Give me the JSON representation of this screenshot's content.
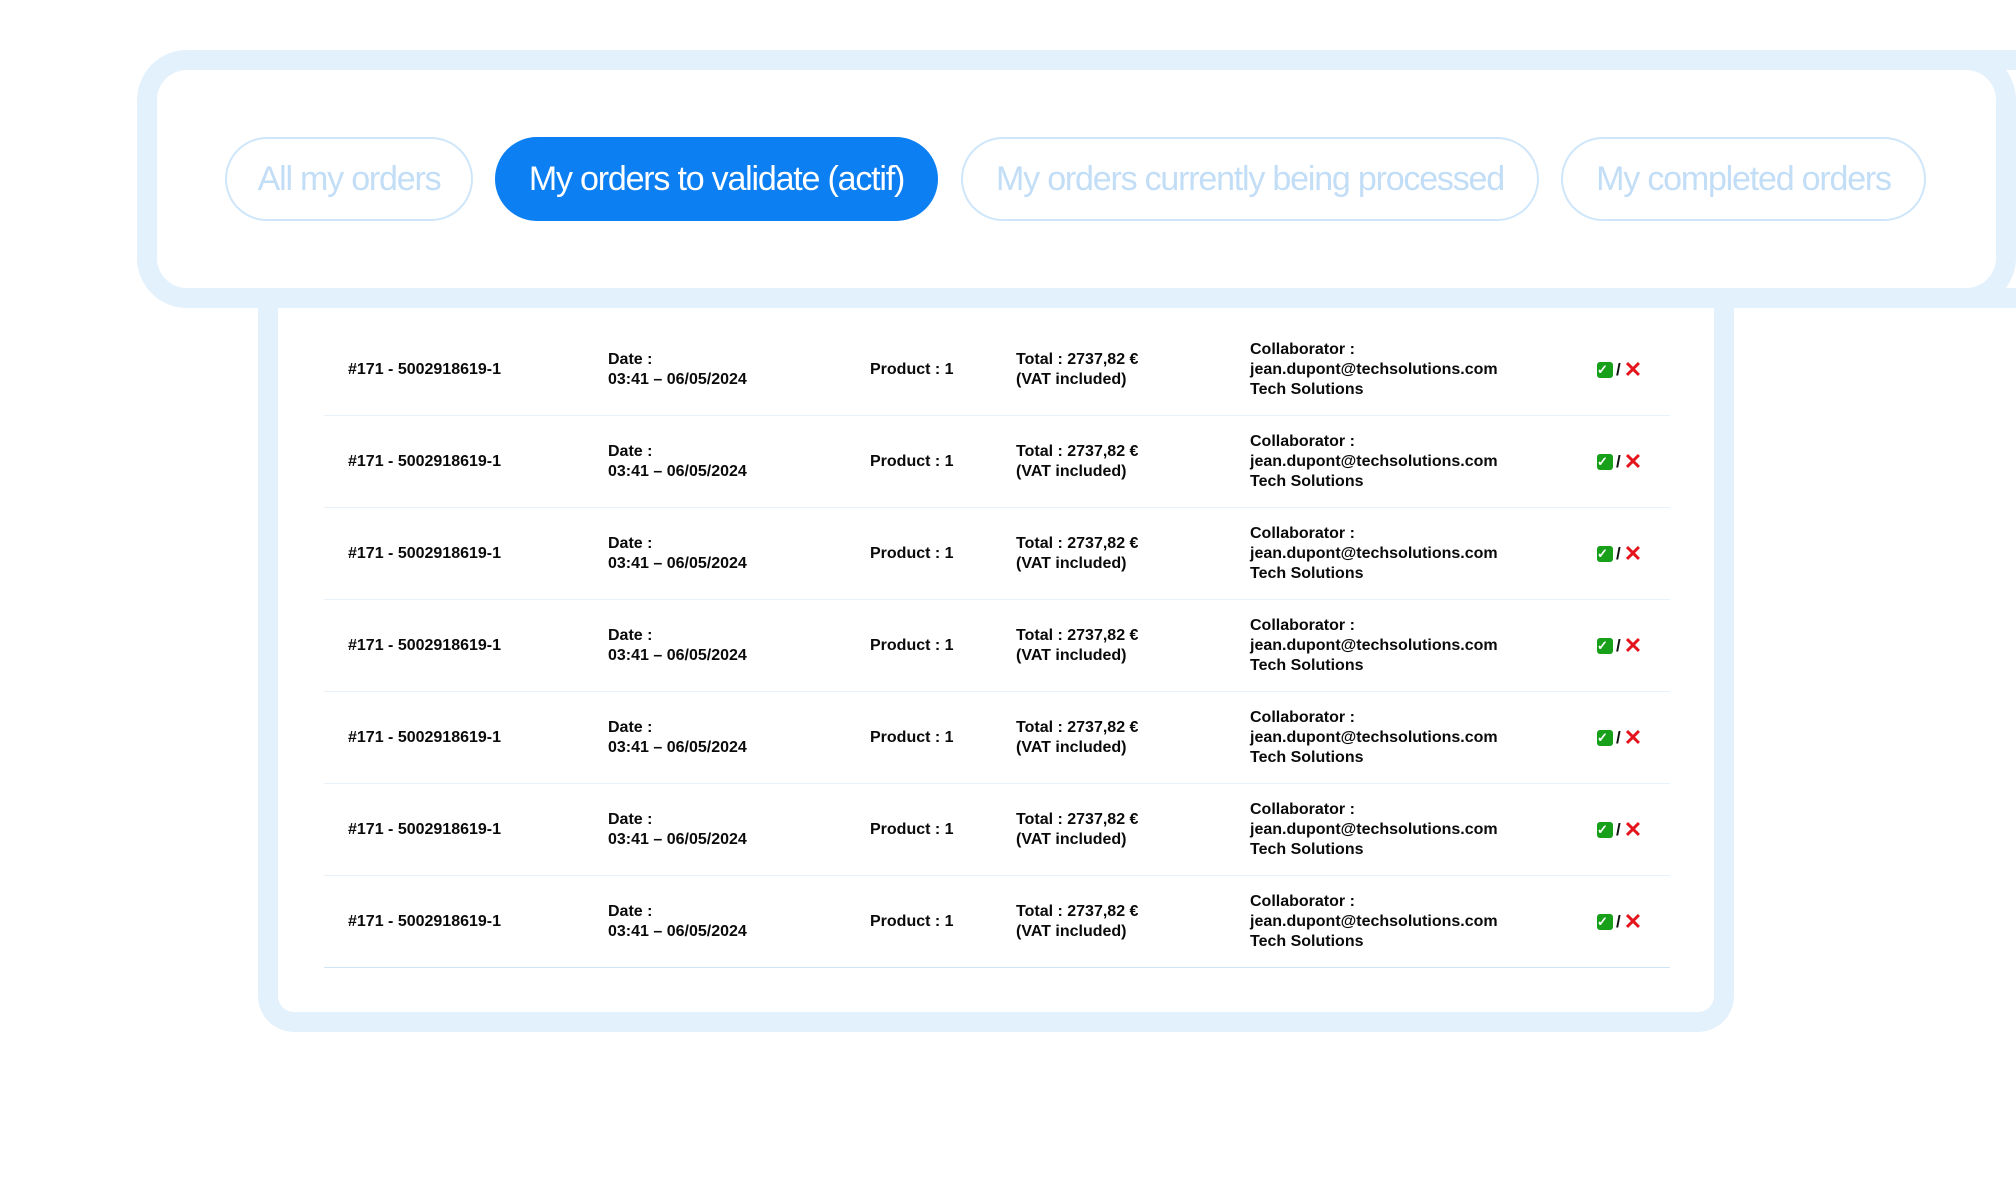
{
  "tabs": [
    {
      "label": "All my orders",
      "active": false
    },
    {
      "label": "My orders to validate (actif)",
      "active": true
    },
    {
      "label": "My orders currently being processed",
      "active": false
    },
    {
      "label": "My completed orders",
      "active": false
    }
  ],
  "orders": [
    {
      "id": "#171 - 5002918619-1",
      "date_label": "Date :",
      "date_value": "03:41 – 06/05/2024",
      "product": "Product : 1",
      "total": "Total : 2737,82 €",
      "vat": "(VAT included)",
      "collab_label": "Collaborator :",
      "collab_email": "jean.dupont@techsolutions.com",
      "collab_company": "Tech Solutions"
    },
    {
      "id": "#171 - 5002918619-1",
      "date_label": "Date :",
      "date_value": "03:41 – 06/05/2024",
      "product": "Product : 1",
      "total": "Total : 2737,82 €",
      "vat": "(VAT included)",
      "collab_label": "Collaborator :",
      "collab_email": "jean.dupont@techsolutions.com",
      "collab_company": "Tech Solutions"
    },
    {
      "id": "#171 - 5002918619-1",
      "date_label": "Date :",
      "date_value": "03:41 – 06/05/2024",
      "product": "Product : 1",
      "total": "Total : 2737,82 €",
      "vat": "(VAT included)",
      "collab_label": "Collaborator :",
      "collab_email": "jean.dupont@techsolutions.com",
      "collab_company": "Tech Solutions"
    },
    {
      "id": "#171 - 5002918619-1",
      "date_label": "Date :",
      "date_value": "03:41 – 06/05/2024",
      "product": "Product : 1",
      "total": "Total : 2737,82 €",
      "vat": "(VAT included)",
      "collab_label": "Collaborator :",
      "collab_email": "jean.dupont@techsolutions.com",
      "collab_company": "Tech Solutions"
    },
    {
      "id": "#171 - 5002918619-1",
      "date_label": "Date :",
      "date_value": "03:41 – 06/05/2024",
      "product": "Product : 1",
      "total": "Total : 2737,82 €",
      "vat": "(VAT included)",
      "collab_label": "Collaborator :",
      "collab_email": "jean.dupont@techsolutions.com",
      "collab_company": "Tech Solutions"
    },
    {
      "id": "#171 - 5002918619-1",
      "date_label": "Date :",
      "date_value": "03:41 – 06/05/2024",
      "product": "Product : 1",
      "total": "Total : 2737,82 €",
      "vat": "(VAT included)",
      "collab_label": "Collaborator :",
      "collab_email": "jean.dupont@techsolutions.com",
      "collab_company": "Tech Solutions"
    },
    {
      "id": "#171 - 5002918619-1",
      "date_label": "Date :",
      "date_value": "03:41 – 06/05/2024",
      "product": "Product : 1",
      "total": "Total : 2737,82 €",
      "vat": "(VAT included)",
      "collab_label": "Collaborator :",
      "collab_email": "jean.dupont@techsolutions.com",
      "collab_company": "Tech Solutions"
    }
  ],
  "actions": {
    "validate_icon": "check-icon",
    "separator": "/",
    "reject_icon": "cross-icon"
  },
  "colors": {
    "accent": "#0c7ff2",
    "tab_inactive_text": "#c2ddf6",
    "frame": "#e3f1fd",
    "validate": "#19a01b",
    "reject": "#e3141b"
  }
}
